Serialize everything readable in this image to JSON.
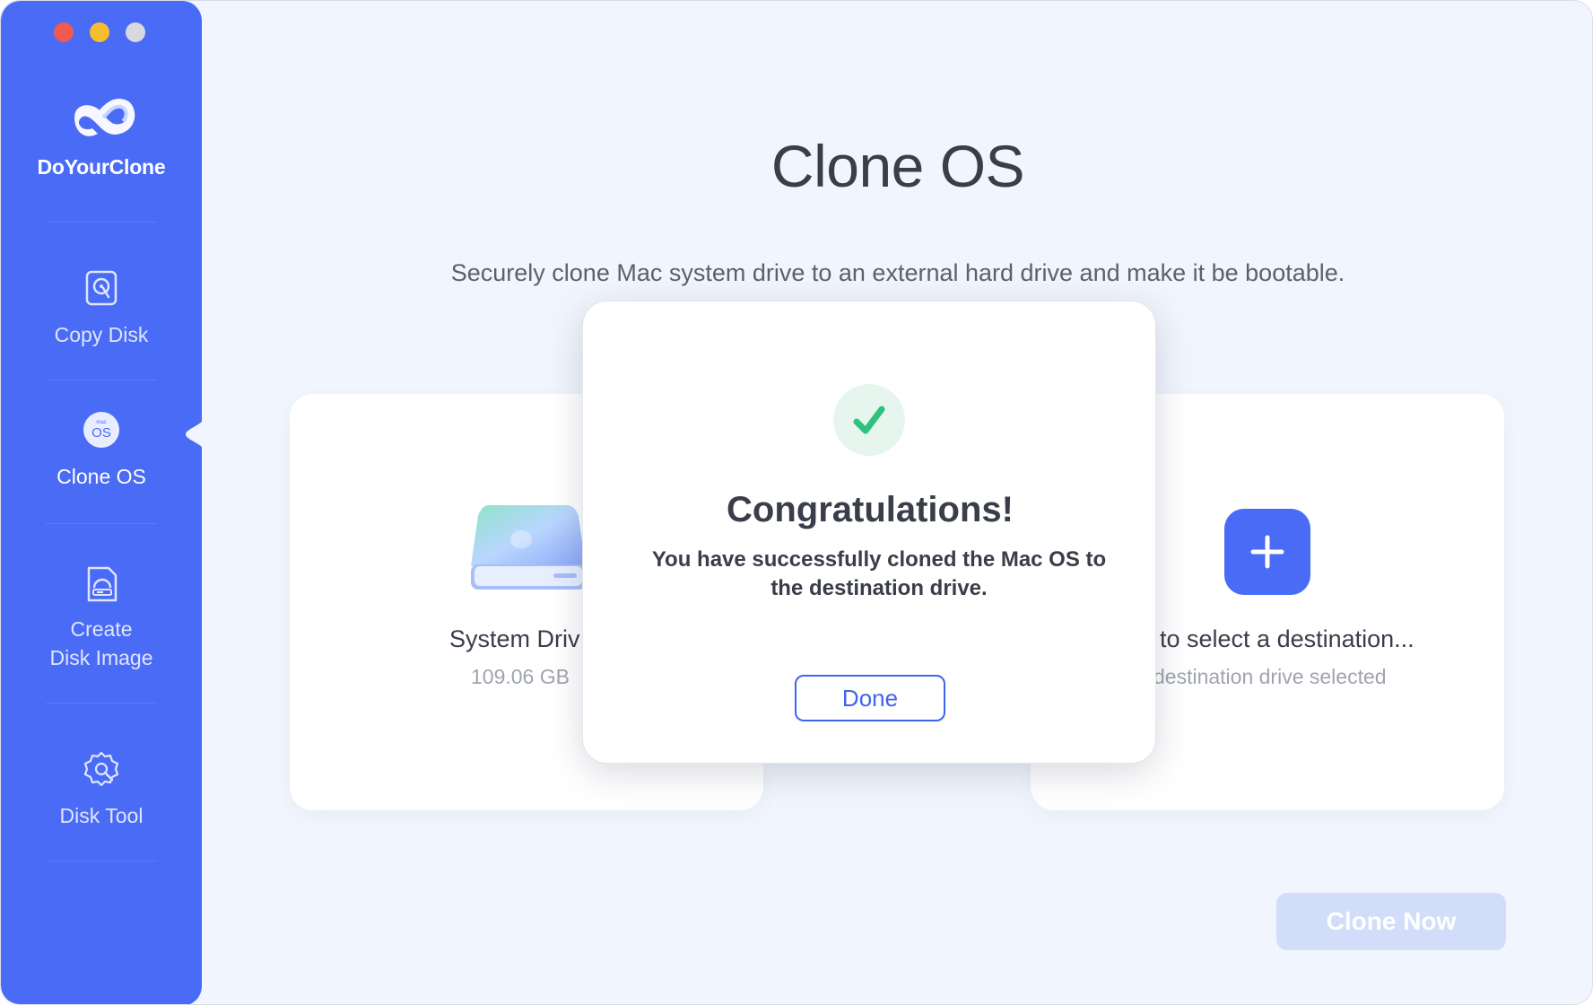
{
  "window": {
    "traffic_lights": [
      "close",
      "minimize",
      "maximize"
    ]
  },
  "sidebar": {
    "app_name": "DoYourClone",
    "items": [
      {
        "label": "Copy Disk",
        "icon": "copy-disk-icon",
        "active": false
      },
      {
        "label": "Clone OS",
        "icon": "macos-icon",
        "active": true
      },
      {
        "label_line1": "Create",
        "label_line2": "Disk Image",
        "icon": "disk-image-icon",
        "active": false
      },
      {
        "label": "Disk Tool",
        "icon": "gear-wrench-icon",
        "active": false
      }
    ],
    "accent": "#4a6bf5"
  },
  "main": {
    "title": "Clone OS",
    "subtitle": "Securely clone Mac system drive to an external hard drive and make it be bootable.",
    "source_card": {
      "title": "System Driv",
      "size": "109.06 GB"
    },
    "destination_card": {
      "title": "to select a destination...",
      "subtitle": "destination drive selected"
    },
    "clone_button": "Clone Now"
  },
  "modal": {
    "title": "Congratulations!",
    "message": "You have successfully cloned the Mac OS to the destination drive.",
    "done_button": "Done",
    "icon": "checkmark-icon",
    "success_color": "#2ec27e"
  }
}
